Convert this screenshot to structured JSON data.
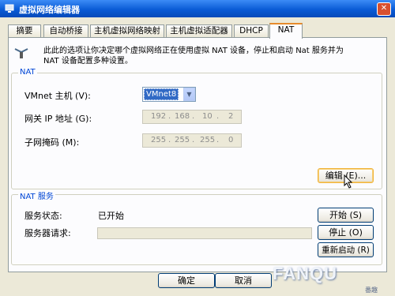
{
  "window": {
    "title": "虚拟网络编辑器"
  },
  "tabs": [
    {
      "label": "摘要"
    },
    {
      "label": "自动桥接"
    },
    {
      "label": "主机虚拟网络映射"
    },
    {
      "label": "主机虚拟适配器"
    },
    {
      "label": "DHCP"
    },
    {
      "label": "NAT"
    }
  ],
  "description": {
    "line1": "此此的选项让你决定哪个虚拟网络正在使用虚拟 NAT 设备，停止和启动 Nat 服务并为",
    "line2": "NAT 设备配置多种设置。"
  },
  "nat_group": {
    "legend": "NAT",
    "vmnet_host_label": "VMnet 主机 (V):",
    "vmnet_host_value": "VMnet8",
    "gateway_label": "网关 IP 地址 (G):",
    "gateway_octets": [
      "192",
      "168",
      "10",
      "2"
    ],
    "subnet_label": "子网掩码 (M):",
    "subnet_octets": [
      "255",
      "255",
      "255",
      "0"
    ],
    "edit_button": "编辑 (E)..."
  },
  "nat_service": {
    "legend": "NAT 服务",
    "status_label": "服务状态:",
    "status_value": "已开始",
    "request_label": "服务器请求:",
    "start_button": "开始 (S)",
    "stop_button": "停止 (O)",
    "restart_button": "重新启动 (R)"
  },
  "footer": {
    "ok_button": "确定",
    "cancel_button": "取消"
  },
  "watermark": {
    "text": "FANQU",
    "suffix": "番趣"
  },
  "colors": {
    "title_bar": "#0a5bd6",
    "active_tab_accent": "#e68b2c",
    "legend_text": "#0046d5"
  }
}
